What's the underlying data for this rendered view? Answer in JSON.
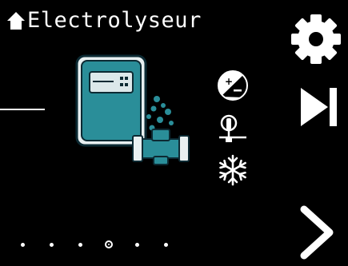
{
  "header": {
    "title": "Electrolyseur"
  },
  "icons": {
    "home": "home-icon",
    "settings": "gear-icon",
    "skip": "skip-next-icon",
    "next": "chevron-right-icon",
    "polarity": "plus-minus-icon",
    "flow_switch": "flow-switch-icon",
    "frost": "snowflake-icon"
  },
  "pager": {
    "count": 6,
    "active_index": 3
  },
  "colors": {
    "background": "#000000",
    "foreground": "#ffffff",
    "accent": "#1f8c97"
  }
}
